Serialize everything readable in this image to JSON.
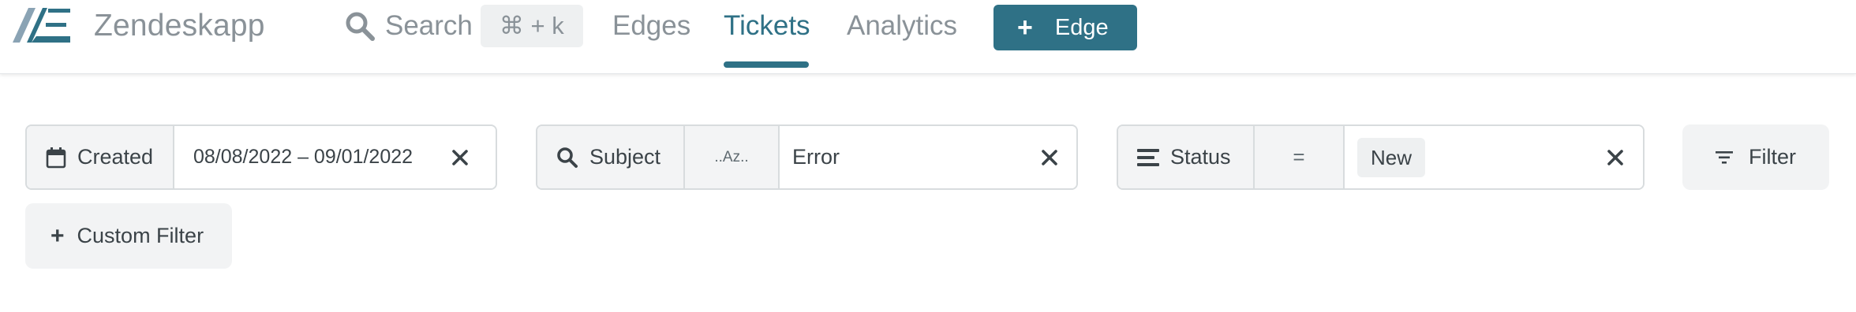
{
  "app": {
    "name": "Zendeskapp"
  },
  "search": {
    "label": "Search",
    "shortcut": "⌘ + k",
    "icon": "search-icon"
  },
  "nav": {
    "tabs": [
      {
        "label": "Edges",
        "active": false
      },
      {
        "label": "Tickets",
        "active": true
      },
      {
        "label": "Analytics",
        "active": false
      }
    ],
    "add_button": {
      "label": "Edge",
      "icon": "plus-icon"
    }
  },
  "filters": {
    "created": {
      "label": "Created",
      "icon": "calendar-icon",
      "value": "08/08/2022 – 09/01/2022"
    },
    "subject": {
      "label": "Subject",
      "icon": "search-icon",
      "operator": "..Az..",
      "value": "Error"
    },
    "status": {
      "label": "Status",
      "icon": "list-icon",
      "operator": "=",
      "value": "New"
    },
    "filter_button": {
      "label": "Filter",
      "icon": "filter-lines-icon"
    },
    "custom_filter_button": {
      "label": "Custom Filter",
      "icon": "plus-icon"
    }
  },
  "colors": {
    "accent": "#2f7186",
    "muted_text": "#8a9298",
    "body_text": "#3b4348",
    "border": "#d8dcde",
    "segment_bg": "#f3f4f5"
  }
}
